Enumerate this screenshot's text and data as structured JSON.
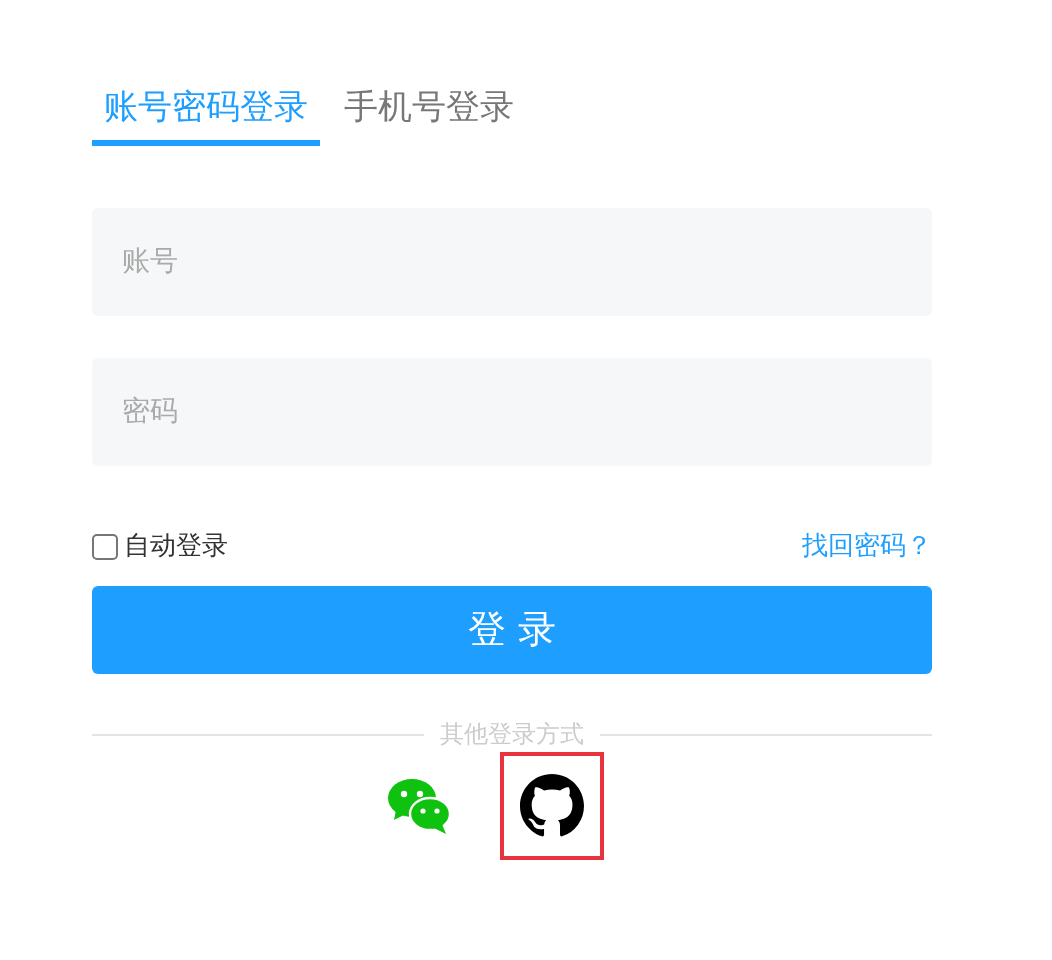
{
  "tabs": [
    {
      "label": "账号密码登录",
      "selected": true
    },
    {
      "label": "手机号登录",
      "selected": false
    }
  ],
  "fields": [
    {
      "placeholder": "账号"
    },
    {
      "placeholder": "密码"
    }
  ],
  "auto_login": {
    "label": "自动登录",
    "checked": false
  },
  "forgot_link": "找回密码？",
  "login_button": "登 录",
  "divider_text": "其他登录方式",
  "social": [
    {
      "kind": "chat",
      "selected": false
    },
    {
      "kind": "cat",
      "selected": true
    }
  ]
}
